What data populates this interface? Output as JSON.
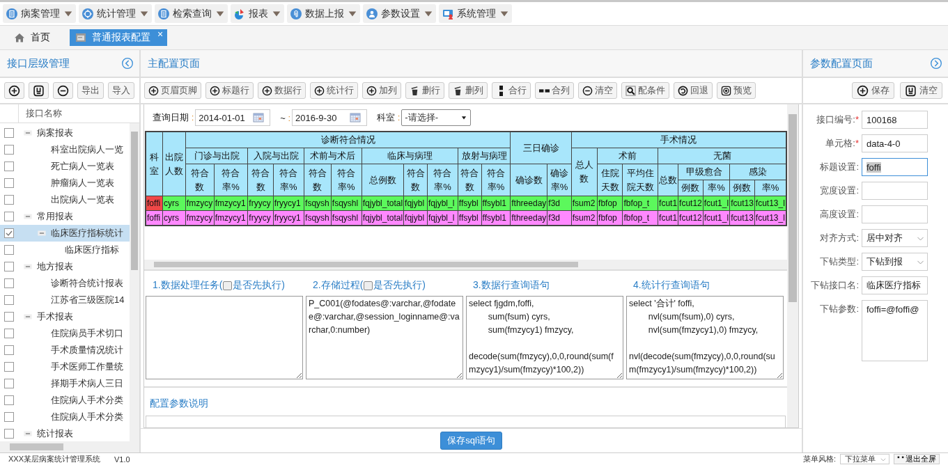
{
  "menu": [
    {
      "label": "病案管理",
      "kind": "document"
    },
    {
      "label": "统计管理",
      "kind": "crosshair"
    },
    {
      "label": "检索查询",
      "kind": "document"
    },
    {
      "label": "报表",
      "kind": "pie"
    },
    {
      "label": "数据上报",
      "kind": "clip"
    },
    {
      "label": "参数设置",
      "kind": "person"
    },
    {
      "label": "系统管理",
      "kind": "monitor"
    }
  ],
  "tabs": [
    {
      "label": "首页",
      "kind": "home",
      "selected": false
    },
    {
      "label": "普通报表配置",
      "kind": "window",
      "selected": true,
      "close": "×"
    }
  ],
  "left_panel": {
    "title": "接口层级管理",
    "buttons": [
      {
        "kind": "plus"
      },
      {
        "kind": "disk"
      },
      {
        "kind": "minus"
      },
      {
        "label": "导出"
      },
      {
        "label": "导入"
      }
    ],
    "column": "接口名称",
    "tree": [
      {
        "label": "病案报表",
        "checked": false,
        "selected": false,
        "expanded": true,
        "children": [
          {
            "label": "科室出院病人一览",
            "checked": false,
            "selected": false
          },
          {
            "label": "死亡病人一览表",
            "checked": false,
            "selected": false
          },
          {
            "label": "肿瘤病人一览表",
            "checked": false,
            "selected": false
          },
          {
            "label": "出院病人一览表",
            "checked": false,
            "selected": false
          }
        ]
      },
      {
        "label": "常用报表",
        "checked": false,
        "selected": false,
        "expanded": true,
        "children": [
          {
            "label": "临床医疗指标统计",
            "checked": true,
            "selected": true,
            "expanded": true,
            "children": [
              {
                "label": "临床医疗指标",
                "checked": false,
                "selected": false
              }
            ]
          }
        ]
      },
      {
        "label": "地方报表",
        "checked": false,
        "selected": false,
        "expanded": true,
        "children": [
          {
            "label": "诊断符合统计报表",
            "checked": false,
            "selected": false
          },
          {
            "label": "江苏省三级医院14",
            "checked": false,
            "selected": false
          }
        ]
      },
      {
        "label": "手术报表",
        "checked": false,
        "selected": false,
        "expanded": true,
        "children": [
          {
            "label": "住院病员手术切口",
            "checked": false,
            "selected": false
          },
          {
            "label": "手术质量情况统计",
            "checked": false,
            "selected": false
          },
          {
            "label": "手术医师工作量统",
            "checked": false,
            "selected": false
          },
          {
            "label": "择期手术病人三日",
            "checked": false,
            "selected": false
          },
          {
            "label": "住院病人手术分类",
            "checked": false,
            "selected": false
          },
          {
            "label": "住院病人手术分类",
            "checked": false,
            "selected": false
          }
        ]
      },
      {
        "label": "统计报表",
        "checked": false,
        "selected": false,
        "expanded": true
      }
    ]
  },
  "main": {
    "title": "主配置页面",
    "toolbar": [
      {
        "label": "页眉页脚",
        "kind": "plus"
      },
      {
        "label": "标题行",
        "kind": "plus"
      },
      {
        "label": "数据行",
        "kind": "plus"
      },
      {
        "label": "统计行",
        "kind": "plus"
      },
      {
        "label": "加列",
        "kind": "plus"
      },
      {
        "label": "删行",
        "kind": "trash"
      },
      {
        "label": "删列",
        "kind": "trash"
      },
      {
        "label": "合行",
        "kind": "vbars"
      },
      {
        "label": "合列",
        "kind": "hbars"
      },
      {
        "label": "清空",
        "kind": "minus"
      },
      {
        "label": "配条件",
        "kind": "search"
      },
      {
        "label": "回退",
        "kind": "undo"
      },
      {
        "label": "预览",
        "kind": "target"
      }
    ],
    "query": {
      "date_label": {
        "text": "查询日期",
        "mark": ":"
      },
      "date_from": "2014-01-01",
      "sep_label": {
        "text": "~",
        "mark": ":"
      },
      "date_to": "2016-9-30",
      "dept_label": {
        "text": "科室",
        "mark": ":"
      },
      "dept": "-请选择-"
    },
    "table": {
      "header_rows": [
        [
          {
            "text": "科室",
            "rowspan": 4
          },
          {
            "text": "出院人数",
            "rowspan": 4
          },
          {
            "text": "诊断符合情况",
            "colspan": 11
          },
          {
            "text": "三日确诊",
            "colspan": 2,
            "rowspan": 2
          },
          {
            "text": "手术情况",
            "colspan": 8
          }
        ],
        [
          {
            "text": "门诊与出院",
            "colspan": 2
          },
          {
            "text": "入院与出院",
            "colspan": 2
          },
          {
            "text": "术前与术后",
            "colspan": 2
          },
          {
            "text": "临床与病理",
            "colspan": 3
          },
          {
            "text": "放射与病理",
            "colspan": 2
          },
          {
            "text": "总人数",
            "rowspan": 3
          },
          {
            "text": "术前",
            "colspan": 2
          },
          {
            "text": "无菌",
            "colspan": 5
          }
        ],
        [
          {
            "text": "符合数",
            "rowspan": 2
          },
          {
            "text": "符合率%",
            "rowspan": 2
          },
          {
            "text": "符合数",
            "rowspan": 2
          },
          {
            "text": "符合率%",
            "rowspan": 2
          },
          {
            "text": "符合数",
            "rowspan": 2
          },
          {
            "text": "符合率%",
            "rowspan": 2
          },
          {
            "text": "总例数",
            "rowspan": 2
          },
          {
            "text": "符合数",
            "rowspan": 2
          },
          {
            "text": "符合率%",
            "rowspan": 2
          },
          {
            "text": "符合数",
            "rowspan": 2
          },
          {
            "text": "符合率%",
            "rowspan": 2
          },
          {
            "text": "确诊数",
            "rowspan": 2
          },
          {
            "text": "确诊率%",
            "rowspan": 2
          },
          {
            "text": "住院天数",
            "rowspan": 2
          },
          {
            "text": "平均住院天数",
            "rowspan": 2
          },
          {
            "text": "总数",
            "rowspan": 2
          },
          {
            "text": "甲级愈合",
            "colspan": 2
          },
          {
            "text": "感染",
            "colspan": 2
          }
        ],
        [
          {
            "text": "例数"
          },
          {
            "text": "率%"
          },
          {
            "text": "例数"
          },
          {
            "text": "率%"
          }
        ]
      ],
      "rows": [
        {
          "kind": "data",
          "cells": [
            {
              "text": "foffi",
              "selected": true
            },
            {
              "text": "cyrs",
              "selected": false
            },
            {
              "text": "fmzycy",
              "selected": false
            },
            {
              "text": "fmzycy1",
              "selected": false
            },
            {
              "text": "fryycy",
              "selected": false
            },
            {
              "text": "fryycy1",
              "selected": false
            },
            {
              "text": "fsqysh",
              "selected": false
            },
            {
              "text": "fsqyshl",
              "selected": false
            },
            {
              "text": "fqjybl_total",
              "selected": false
            },
            {
              "text": "fqjybl",
              "selected": false
            },
            {
              "text": "fqjybl_l",
              "selected": false
            },
            {
              "text": "ffsybl",
              "selected": false
            },
            {
              "text": "ffsybl1",
              "selected": false
            },
            {
              "text": "fthreeday",
              "selected": false
            },
            {
              "text": "f3d",
              "selected": false
            },
            {
              "text": "fsum2",
              "selected": false
            },
            {
              "text": "fbfop",
              "selected": false
            },
            {
              "text": "fbfop_t",
              "selected": false
            },
            {
              "text": "fcut1",
              "selected": false
            },
            {
              "text": "fcut12",
              "selected": false
            },
            {
              "text": "fcut1_l",
              "selected": false
            },
            {
              "text": "fcut13",
              "selected": false
            },
            {
              "text": "fcut13_l",
              "selected": false
            }
          ]
        },
        {
          "kind": "stat",
          "cells": [
            {
              "text": "foffi",
              "selected": false
            },
            {
              "text": "cyrs",
              "selected": false
            },
            {
              "text": "fmzycy",
              "selected": false
            },
            {
              "text": "fmzycy1",
              "selected": false
            },
            {
              "text": "fryycy",
              "selected": false
            },
            {
              "text": "fryycy1",
              "selected": false
            },
            {
              "text": "fsqysh",
              "selected": false
            },
            {
              "text": "fsqyshl",
              "selected": false
            },
            {
              "text": "fqjybl_total",
              "selected": false
            },
            {
              "text": "fqjybl",
              "selected": false
            },
            {
              "text": "fqjybl_l",
              "selected": false
            },
            {
              "text": "ffsybl",
              "selected": false
            },
            {
              "text": "ffsybl1",
              "selected": false
            },
            {
              "text": "fthreeday",
              "selected": false
            },
            {
              "text": "f3d",
              "selected": false
            },
            {
              "text": "fsum2",
              "selected": false
            },
            {
              "text": "fbfop",
              "selected": false
            },
            {
              "text": "fbfop_t",
              "selected": false
            },
            {
              "text": "fcut1",
              "selected": false
            },
            {
              "text": "fcut12",
              "selected": false
            },
            {
              "text": "fcut1_l",
              "selected": false
            },
            {
              "text": "fcut13",
              "selected": false
            },
            {
              "text": "fcut13_l",
              "selected": false
            }
          ]
        }
      ]
    },
    "scripts": [
      {
        "title": "1.数据处理任务(",
        "option": "是否先执行)",
        "checked": false
      },
      {
        "title": "2.存储过程(",
        "option": "是否先执行)",
        "checked": false,
        "text": "P_C001(@fodates@:varchar,@fodatee@:varchar,@session_loginname@:varchar,0:number)"
      },
      {
        "title": "3.数据行查询语句",
        "text": "select fjgdm,foffi,\n        sum(fsum) cyrs,\n        sum(fmzycy1) fmzycy,\n\ndecode(sum(fmzycy),0,0,round(sum(fmzycy1)/sum(fmzycy)*100,2))"
      },
      {
        "title": "4.统计行查询语句",
        "text": "select '合计' foffi,\n        nvl(sum(fsum),0) cyrs,\n        nvl(sum(fmzycy1),0) fmzycy,\n\nnvl(decode(sum(fmzycy),0,0,round(sum(fmzycy1)/sum(fmzycy)*100,2))"
      }
    ],
    "notes_title": "配置参数说明",
    "save_button": "保存sql语句"
  },
  "right_panel": {
    "title": "参数配置页面",
    "buttons": [
      {
        "kind": "plus",
        "label": "保存"
      },
      {
        "kind": "disk",
        "label": "清空"
      }
    ],
    "fields": [
      {
        "label": "接口编号:",
        "mark": "*",
        "kind": "input",
        "value": "100168",
        "focused": false
      },
      {
        "label": "单元格:",
        "mark": "*",
        "kind": "input",
        "value": "data-4-0",
        "focused": false
      },
      {
        "label": "标题设置:",
        "kind": "input",
        "value": "foffi",
        "focused": true
      },
      {
        "label": "宽度设置:",
        "kind": "input",
        "focused": false
      },
      {
        "label": "高度设置:",
        "kind": "input",
        "focused": false
      },
      {
        "label": "对齐方式:",
        "kind": "select",
        "value": "居中对齐",
        "focused": false
      },
      {
        "label": "下钻类型:",
        "kind": "select",
        "value": "下钻到报",
        "focused": false
      },
      {
        "label": "下钻接口名:",
        "kind": "input",
        "value": "临床医疗指标",
        "focused": false
      },
      {
        "label": "下钻参数:",
        "kind": "textarea",
        "value": "foffi=@foffi@",
        "focused": false
      }
    ]
  },
  "footer": {
    "system": "XXX某层病案统计管理系统",
    "version": "V1.0",
    "style_label": "菜单风格:",
    "style_value": "下拉菜单",
    "fullscreen": "退出全屏"
  }
}
